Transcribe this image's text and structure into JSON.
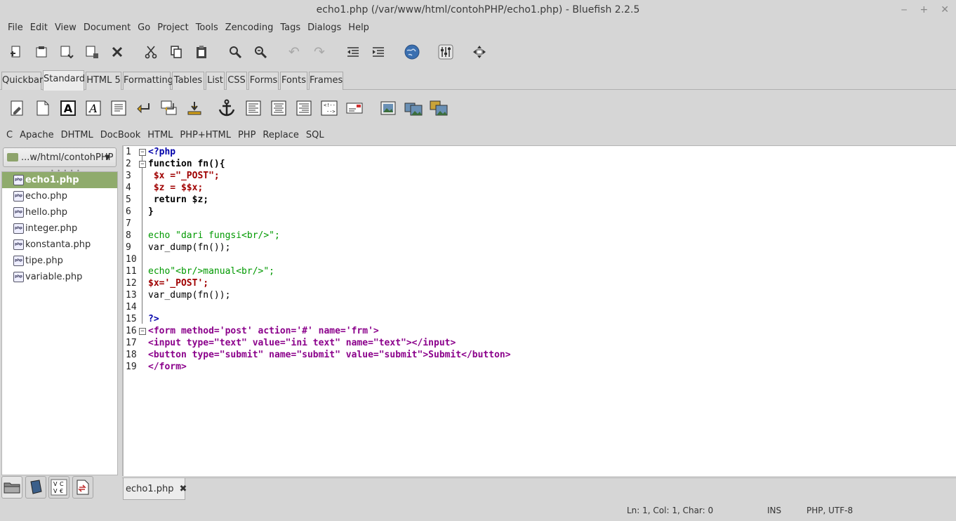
{
  "window": {
    "title": "echo1.php (/var/www/html/contohPHP/echo1.php) - Bluefish 2.2.5",
    "controls": [
      "‒",
      "+",
      "✕"
    ]
  },
  "menu": [
    "File",
    "Edit",
    "View",
    "Document",
    "Go",
    "Project",
    "Tools",
    "Zencoding",
    "Tags",
    "Dialogs",
    "Help"
  ],
  "toolbar_tabs": [
    "Quickbar",
    "Standard",
    "HTML 5",
    "Formatting",
    "Tables",
    "List",
    "CSS",
    "Forms",
    "Fonts",
    "Frames"
  ],
  "active_toolbar_tab": "Standard",
  "custom_menu": [
    "C",
    "Apache",
    "DHTML",
    "DocBook",
    "HTML",
    "PHP+HTML",
    "PHP",
    "Replace",
    "SQL"
  ],
  "sidebar": {
    "directory": "...w/html/contohPHP",
    "grip": "• • • • •",
    "file_icon_text": "php",
    "files": [
      "echo1.php",
      "echo.php",
      "hello.php",
      "integer.php",
      "konstanta.php",
      "tipe.php",
      "variable.php"
    ],
    "selected_file": "echo1.php",
    "tab_icons": [
      "folder-icon",
      "bookmark-icon",
      "charmap-icon",
      "snippets-icon"
    ]
  },
  "editor": {
    "line_numbers": [
      "1",
      "2",
      "3",
      "4",
      "5",
      "6",
      "7",
      "8",
      "9",
      "10",
      "11",
      "12",
      "13",
      "14",
      "15",
      "16",
      "17",
      "18",
      "19"
    ],
    "lines": [
      "<?php",
      "function fn(){",
      " $x =\"_POST\";",
      " $z = $$x;",
      " return $z;",
      "}",
      "",
      "echo \"dari fungsi<br/>\";",
      "var_dump(fn());",
      "",
      "echo\"<br/>manual<br/>\";",
      "$x='_POST';",
      "var_dump(fn());",
      "",
      "?>",
      "<form method='post' action='#' name='frm'>",
      "<input type=\"text\" value=\"ini text\" name=\"text\"></input>",
      "<button type=\"submit\" name=\"submit\" value=\"submit\">Submit</button>",
      "</form>"
    ]
  },
  "document_tabs": [
    {
      "label": "echo1.php",
      "close": "✖"
    }
  ],
  "status": {
    "position": "Ln: 1, Col: 1, Char: 0",
    "mode": "INS",
    "encoding": "PHP, UTF-8"
  }
}
